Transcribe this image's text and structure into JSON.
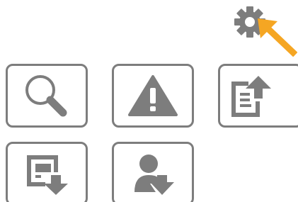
{
  "colors": {
    "icon": "#7d7d7d",
    "border": "#7d7d7d",
    "accent": "#f5a623",
    "background": "#ffffff"
  },
  "settings": {
    "icon": "gear-icon",
    "pointer": "arrow-pointer-icon"
  },
  "tiles": [
    {
      "icon": "search-icon"
    },
    {
      "icon": "warning-icon"
    },
    {
      "icon": "document-upload-icon"
    },
    {
      "icon": "screen-download-icon"
    },
    {
      "icon": "user-download-icon"
    }
  ]
}
